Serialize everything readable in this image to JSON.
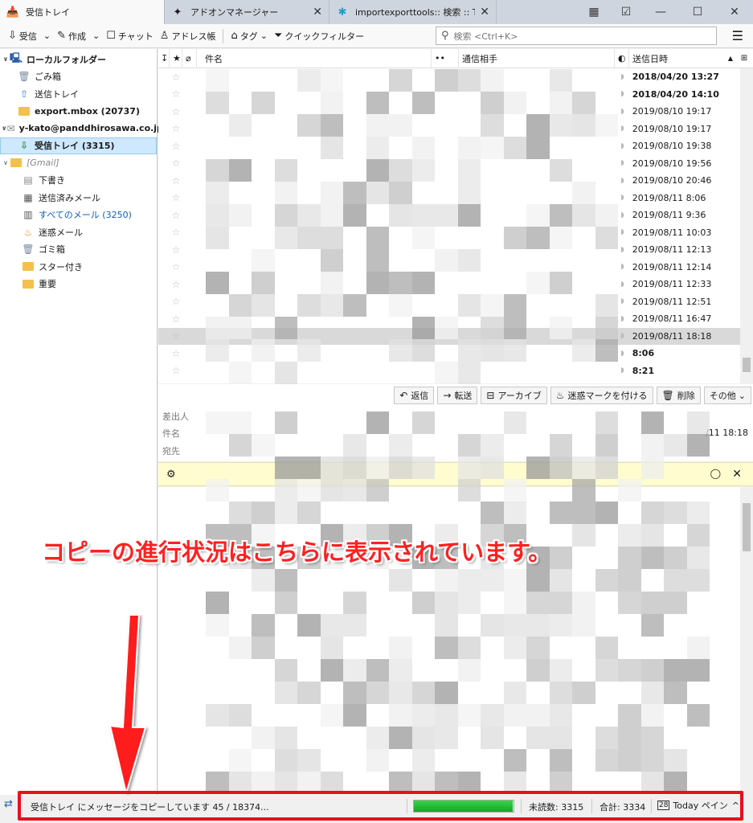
{
  "tabs": [
    {
      "label": "受信トレイ",
      "icon": "inbox-icon"
    },
    {
      "label": "アドオンマネージャー",
      "icon": "puzzle-icon"
    },
    {
      "label": "importexporttools:: 検索 :: T",
      "icon": "addon-icon"
    }
  ],
  "window_controls": {
    "calendar": "▦",
    "tasks": "☑",
    "minimize": "—",
    "maximize": "☐",
    "close": "✕"
  },
  "toolbar": {
    "get_mail": "受信",
    "write": "作成",
    "chat": "チャット",
    "address_book": "アドレス帳",
    "tag": "タグ",
    "quick_filter": "クイックフィルター",
    "search_placeholder": "検索 <Ctrl+K>"
  },
  "folders": [
    {
      "label": "ローカルフォルダー",
      "indent": 0,
      "bold": true,
      "icon": "computer-icon",
      "twisty": "∨"
    },
    {
      "label": "ごみ箱",
      "indent": 1,
      "icon": "trash-icon"
    },
    {
      "label": "送信トレイ",
      "indent": 1,
      "icon": "outbox-icon"
    },
    {
      "label": "export.mbox (20737)",
      "indent": 1,
      "bold": true,
      "icon": "folder-icon"
    },
    {
      "label": "y-kato@panddhirosawa.co.jp",
      "indent": 0,
      "bold": true,
      "icon": "account-icon",
      "twisty": "∨"
    },
    {
      "label": "受信トレイ (3315)",
      "indent": 1,
      "bold": true,
      "icon": "inbox-icon",
      "selected": true
    },
    {
      "label": "[Gmail]",
      "indent": 0,
      "gmail": true,
      "icon": "folder-icon",
      "twisty": "∨"
    },
    {
      "label": "下書き",
      "indent": 1,
      "icon": "drafts-icon"
    },
    {
      "label": "送信済みメール",
      "indent": 1,
      "icon": "sent-icon"
    },
    {
      "label": "すべてのメール (3250)",
      "indent": 1,
      "blue": true,
      "icon": "archive-icon"
    },
    {
      "label": "迷惑メール",
      "indent": 1,
      "icon": "junk-icon"
    },
    {
      "label": "ゴミ箱",
      "indent": 1,
      "icon": "trash-icon"
    },
    {
      "label": "スター付き",
      "indent": 1,
      "icon": "folder-icon"
    },
    {
      "label": "重要",
      "indent": 1,
      "icon": "folder-icon"
    }
  ],
  "thread_columns": {
    "subject": "件名",
    "correspondent": "通信相手",
    "date": "送信日時"
  },
  "threads": [
    {
      "date": "2018/04/20 13:27",
      "bold": true
    },
    {
      "date": "2018/04/20 14:10",
      "bold": true
    },
    {
      "date": "2019/08/10 19:17"
    },
    {
      "date": "2019/08/10 19:17"
    },
    {
      "date": "2019/08/10 19:38"
    },
    {
      "date": "2019/08/10 19:56"
    },
    {
      "date": "2019/08/10 20:46"
    },
    {
      "date": "2019/08/11 8:06"
    },
    {
      "date": "2019/08/11 9:36"
    },
    {
      "date": "2019/08/11 10:03"
    },
    {
      "date": "2019/08/11 12:13"
    },
    {
      "date": "2019/08/11 12:14"
    },
    {
      "date": "2019/08/11 12:33"
    },
    {
      "date": "2019/08/11 12:51"
    },
    {
      "date": "2019/08/11 16:47"
    },
    {
      "date": "2019/08/11 18:18",
      "selected": true
    },
    {
      "date": "8:06",
      "bold": true
    },
    {
      "date": "8:21",
      "bold": true
    }
  ],
  "message_actions": {
    "reply": "返信",
    "forward": "転送",
    "archive": "アーカイブ",
    "junk": "迷惑マークを付ける",
    "delete": "削除",
    "other": "その他"
  },
  "message_header": {
    "from_label": "差出人",
    "subject_label": "件名",
    "to_label": "宛先",
    "date": "/11 18:18"
  },
  "remote_bar": {
    "close": "✕"
  },
  "annotation": "コピーの進行状況はこちらに表示されています。",
  "status": {
    "text": "受信トレイ にメッセージをコピーしています 45 / 18374...",
    "progress": 0.99,
    "unread": "未読数: 3315",
    "total": "合計: 3334",
    "today_pane": "Today ペイン",
    "today_icon_text": "28"
  },
  "colors": {
    "annotation": "#ff2020",
    "frame": "#e8101c",
    "progress": "#1bb233"
  }
}
